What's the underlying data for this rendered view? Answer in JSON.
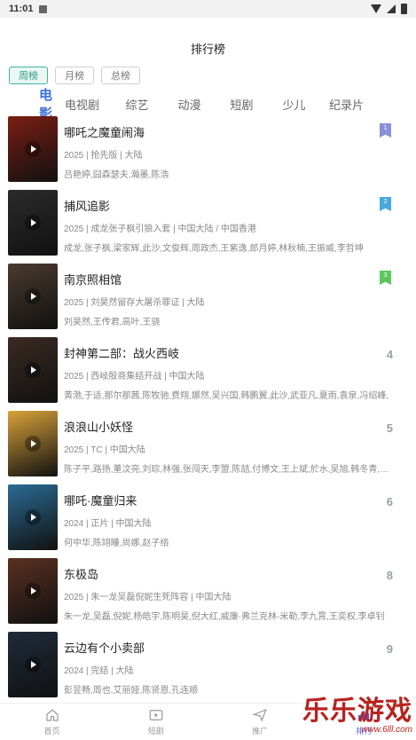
{
  "status_bar": {
    "time": "11:01"
  },
  "page_title": "排行榜",
  "period_tabs": [
    {
      "label": "周榜",
      "active": true
    },
    {
      "label": "月榜",
      "active": false
    },
    {
      "label": "总榜",
      "active": false
    }
  ],
  "category_tabs": [
    {
      "label": "电影",
      "active": true
    },
    {
      "label": "电视剧",
      "active": false
    },
    {
      "label": "综艺",
      "active": false
    },
    {
      "label": "动漫",
      "active": false
    },
    {
      "label": "短剧",
      "active": false
    },
    {
      "label": "少儿",
      "active": false
    },
    {
      "label": "纪录片",
      "active": false
    }
  ],
  "items": [
    {
      "rank": "1",
      "title": "哪吒之魔童闹海",
      "meta": "2025 | 抢先版 | 大陆",
      "cast": "吕艳婷,囧森瑟夫,瀚墨,陈浩",
      "poster_color": "#7a1e12"
    },
    {
      "rank": "2",
      "title": "捕风追影",
      "meta": "2025 | 成龙张子枫引狼入套 | 中国大陆 / 中国香港",
      "cast": "成龙,张子枫,梁家辉,此沙,文俊辉,周政杰,王紫逸,郎月婷,林秋楠,王振威,李哲坤",
      "poster_color": "#2b2b2b"
    },
    {
      "rank": "3",
      "title": "南京照相馆",
      "meta": "2025 | 刘昊然留存大屠杀罪证 | 大陆",
      "cast": "刘昊然,王传君,高叶,王骁",
      "poster_color": "#4a3a2e"
    },
    {
      "rank": "4",
      "title": "封神第二部：战火西岐",
      "meta": "2025 | 西岐殷商集结开战 | 中国大陆",
      "cast": "黄渤,于适,那尔那茜,陈牧驰,费翔,娜然,吴兴国,韩鹏翼,此沙,武亚凡,夏雨,袁泉,冯绍峰,",
      "poster_color": "#3a2a22"
    },
    {
      "rank": "5",
      "title": "浪浪山小妖怪",
      "meta": "2025 | TC | 中国大陆",
      "cast": "陈子平,路扬,董汶亮,刘琮,林强,张闯天,李盟,陈喆,付博文,王上斌,於水,吴旭,韩冬青,姜…",
      "poster_color": "#d9a23a"
    },
    {
      "rank": "6",
      "title": "哪吒·魔童归来",
      "meta": "2024 | 正片 | 中国大陆",
      "cast": "何中华,陈翊瞳,尚娜,赵子络",
      "poster_color": "#2a6b94"
    },
    {
      "rank": "8",
      "title": "东极岛",
      "meta": "2025 | 朱一龙吴磊倪妮生死阵容 | 中国大陆",
      "cast": "朱一龙,吴磊,倪妮,杨皓宇,陈明昊,倪大红,威廉·弗兰克林-米勒,李九霄,王奕权,李卓钊",
      "poster_color": "#5a3020"
    },
    {
      "rank": "9",
      "title": "云边有个小卖部",
      "meta": "2024 | 完结 | 大陆",
      "cast": "彭昱畅,周也,艾丽娅,陈贤恩,孔连顺",
      "poster_color": "#1f2b3a"
    }
  ],
  "bottom_nav": [
    {
      "label": "首页",
      "icon": "home-icon",
      "active": false
    },
    {
      "label": "短剧",
      "icon": "video-icon",
      "active": false
    },
    {
      "label": "推广",
      "icon": "send-icon",
      "active": false
    },
    {
      "label": "排行",
      "icon": "chart-icon",
      "active": true
    }
  ],
  "watermark": {
    "title": "乐乐游戏",
    "url": "www.6lll.com"
  },
  "colors": {
    "accent": "#3b6fd8",
    "green": "#3fb59a",
    "nav_active": "#4e5be0"
  }
}
